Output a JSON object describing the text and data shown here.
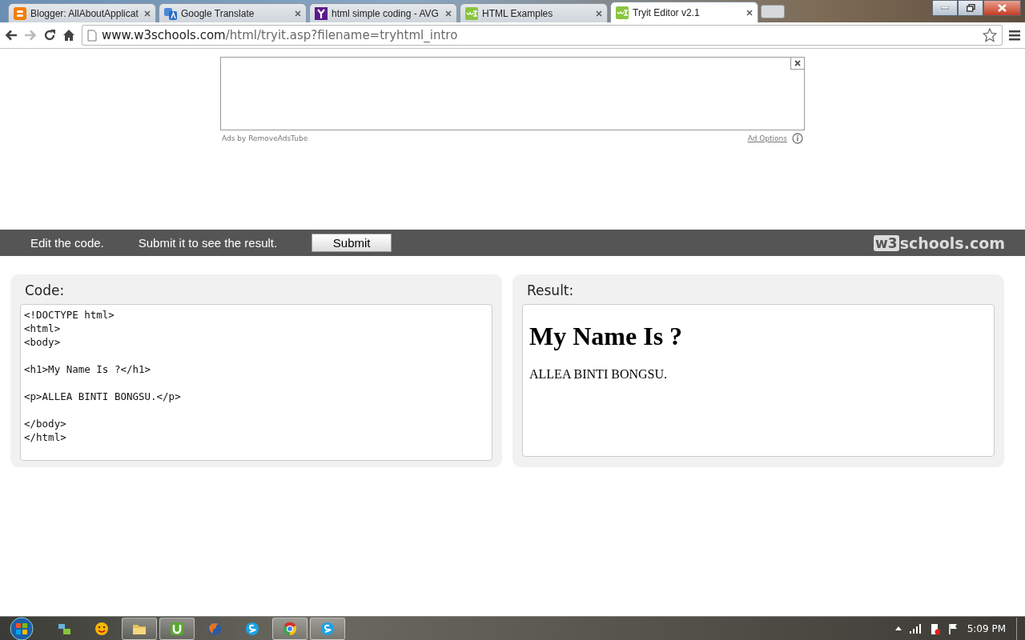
{
  "browser": {
    "tabs": [
      {
        "title": "Blogger: AllAboutApplicat",
        "kind": "blog",
        "selected": false
      },
      {
        "title": "Google Translate",
        "kind": "translate",
        "selected": false
      },
      {
        "title": "html simple coding - AVG",
        "kind": "search",
        "selected": false
      },
      {
        "title": "HTML Examples",
        "kind": "w3",
        "selected": false
      },
      {
        "title": "Tryit Editor v2.1",
        "kind": "w3",
        "selected": true
      }
    ],
    "url_host": "www.w3schools.com",
    "url_path": "/html/tryit.asp?filename=tryhtml_intro"
  },
  "ad": {
    "attribution": "Ads by RemoveAdsTube",
    "options_link": "Ad Options"
  },
  "toolbar": {
    "hint_1": "Edit the code.",
    "hint_2": "Submit it to see the result.",
    "submit_button": "Submit",
    "logo_mark": "w3",
    "logo_text": "schools.com"
  },
  "code_panel": {
    "title": "Code:",
    "code": "<!DOCTYPE html>\n<html>\n<body>\n\n<h1>My Name Is ?</h1>\n\n<p>ALLEA BINTI BONGSU.</p>\n\n</body>\n</html>"
  },
  "result_panel": {
    "title": "Result:",
    "heading": "My Name Is ?",
    "paragraph": "ALLEA BINTI BONGSU."
  },
  "taskbar": {
    "apps": [
      {
        "kind": "network",
        "running": false
      },
      {
        "kind": "smiley",
        "running": false
      },
      {
        "kind": "folder",
        "running": true
      },
      {
        "kind": "torrent",
        "running": true
      },
      {
        "kind": "fox",
        "running": false
      },
      {
        "kind": "chat",
        "running": false
      },
      {
        "kind": "globe",
        "running": true
      },
      {
        "kind": "chat",
        "running": true
      }
    ],
    "clock": "5:09 PM"
  }
}
